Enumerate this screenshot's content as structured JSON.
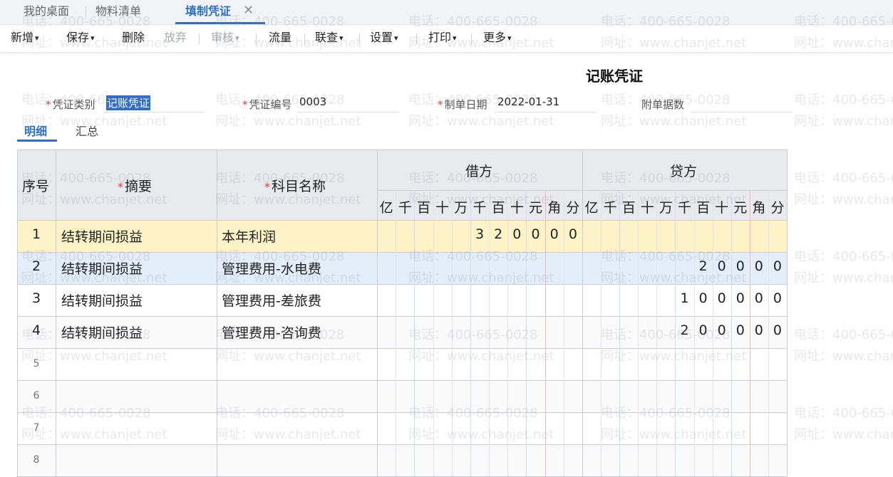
{
  "tabs": [
    {
      "label": "我的桌面"
    },
    {
      "label": "物料清单"
    },
    {
      "label": "填制凭证"
    }
  ],
  "tab_close": "✕",
  "toolbar": {
    "new": "新增",
    "save": "保存",
    "delete": "删除",
    "abandon": "放弃",
    "audit": "审核",
    "flow": "流量",
    "inquiry": "联查",
    "settings": "设置",
    "print": "打印",
    "more": "更多",
    "caret": "▾"
  },
  "watermark": {
    "phone": "电话：400-665-0028",
    "site": "网址：www.chanjet.net"
  },
  "voucher": {
    "title": "记账凭证",
    "required_mark": "*",
    "type_label": "凭证类别",
    "type_value": "记账凭证",
    "number_label": "凭证编号",
    "number_value": "0003",
    "date_label": "制单日期",
    "date_value": "2022-01-31",
    "attach_label": "附单据数",
    "attach_value": ""
  },
  "subtabs": [
    "明细",
    "汇总"
  ],
  "table": {
    "headers": {
      "seq": "序号",
      "summary": "摘要",
      "account": "科目名称",
      "debit": "借方",
      "credit": "贷方"
    },
    "digit_headers": [
      "亿",
      "千",
      "百",
      "十",
      "万",
      "千",
      "百",
      "十",
      "元",
      "角",
      "分"
    ],
    "rows": [
      {
        "seq": "1",
        "summary": "结转期间损益",
        "account": "本年利润",
        "debit": [
          "",
          "",
          "",
          "",
          "",
          "3",
          "2",
          "0",
          "0",
          "0",
          "0"
        ],
        "credit": [
          "",
          "",
          "",
          "",
          "",
          "",
          "",
          "",
          "",
          "",
          ""
        ]
      },
      {
        "seq": "2",
        "summary": "结转期间损益",
        "account": "管理费用-水电费",
        "debit": [
          "",
          "",
          "",
          "",
          "",
          "",
          "",
          "",
          "",
          "",
          ""
        ],
        "credit": [
          "",
          "",
          "",
          "",
          "",
          "",
          "2",
          "0",
          "0",
          "0",
          "0"
        ]
      },
      {
        "seq": "3",
        "summary": "结转期间损益",
        "account": "管理费用-差旅费",
        "debit": [
          "",
          "",
          "",
          "",
          "",
          "",
          "",
          "",
          "",
          "",
          ""
        ],
        "credit": [
          "",
          "",
          "",
          "",
          "",
          "1",
          "0",
          "0",
          "0",
          "0",
          "0"
        ]
      },
      {
        "seq": "4",
        "summary": "结转期间损益",
        "account": "管理费用-咨询费",
        "debit": [
          "",
          "",
          "",
          "",
          "",
          "",
          "",
          "",
          "",
          "",
          ""
        ],
        "credit": [
          "",
          "",
          "",
          "",
          "",
          "2",
          "0",
          "0",
          "0",
          "0",
          "0"
        ]
      },
      {
        "seq": "5",
        "summary": "",
        "account": "",
        "debit": [
          "",
          "",
          "",
          "",
          "",
          "",
          "",
          "",
          "",
          "",
          ""
        ],
        "credit": [
          "",
          "",
          "",
          "",
          "",
          "",
          "",
          "",
          "",
          "",
          ""
        ]
      },
      {
        "seq": "6",
        "summary": "",
        "account": "",
        "debit": [
          "",
          "",
          "",
          "",
          "",
          "",
          "",
          "",
          "",
          "",
          ""
        ],
        "credit": [
          "",
          "",
          "",
          "",
          "",
          "",
          "",
          "",
          "",
          "",
          ""
        ]
      },
      {
        "seq": "7",
        "summary": "",
        "account": "",
        "debit": [
          "",
          "",
          "",
          "",
          "",
          "",
          "",
          "",
          "",
          "",
          ""
        ],
        "credit": [
          "",
          "",
          "",
          "",
          "",
          "",
          "",
          "",
          "",
          "",
          ""
        ]
      },
      {
        "seq": "8",
        "summary": "",
        "account": "",
        "debit": [
          "",
          "",
          "",
          "",
          "",
          "",
          "",
          "",
          "",
          "",
          ""
        ],
        "credit": [
          "",
          "",
          "",
          "",
          "",
          "",
          "",
          "",
          "",
          "",
          ""
        ]
      }
    ]
  },
  "colors": {
    "accent": "#2f6fc7",
    "required": "#e53935",
    "row_selected": "#fdf3c7",
    "row_hover": "#e3eefb",
    "header_bg": "#e9eaed"
  }
}
